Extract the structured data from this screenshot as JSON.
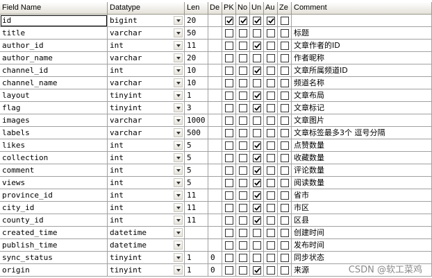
{
  "headers": [
    "Field Name",
    "Datatype",
    "Len",
    "De",
    "PK",
    "No",
    "Un",
    "Au",
    "Ze",
    "Comment"
  ],
  "rows": [
    {
      "name": "id",
      "type": "bigint",
      "len": "20",
      "def": "",
      "pk": true,
      "nn": true,
      "un": true,
      "ai": true,
      "zf": false,
      "comment": ""
    },
    {
      "name": "title",
      "type": "varchar",
      "len": "50",
      "def": "",
      "pk": false,
      "nn": false,
      "un": false,
      "ai": false,
      "zf": false,
      "comment": "标题"
    },
    {
      "name": "author_id",
      "type": "int",
      "len": "11",
      "def": "",
      "pk": false,
      "nn": false,
      "un": true,
      "ai": false,
      "zf": false,
      "comment": "文章作者的ID"
    },
    {
      "name": "author_name",
      "type": "varchar",
      "len": "20",
      "def": "",
      "pk": false,
      "nn": false,
      "un": false,
      "ai": false,
      "zf": false,
      "comment": "作者昵称"
    },
    {
      "name": "channel_id",
      "type": "int",
      "len": "10",
      "def": "",
      "pk": false,
      "nn": false,
      "un": true,
      "ai": false,
      "zf": false,
      "comment": "文章所属频道ID"
    },
    {
      "name": "channel_name",
      "type": "varchar",
      "len": "10",
      "def": "",
      "pk": false,
      "nn": false,
      "un": false,
      "ai": false,
      "zf": false,
      "comment": "频道名称"
    },
    {
      "name": "layout",
      "type": "tinyint",
      "len": "1",
      "def": "",
      "pk": false,
      "nn": false,
      "un": true,
      "ai": false,
      "zf": false,
      "comment": "文章布局"
    },
    {
      "name": "flag",
      "type": "tinyint",
      "len": "3",
      "def": "",
      "pk": false,
      "nn": false,
      "un": true,
      "ai": false,
      "zf": false,
      "comment": "文章标记"
    },
    {
      "name": "images",
      "type": "varchar",
      "len": "1000",
      "def": "",
      "pk": false,
      "nn": false,
      "un": false,
      "ai": false,
      "zf": false,
      "comment": "文章图片"
    },
    {
      "name": "labels",
      "type": "varchar",
      "len": "500",
      "def": "",
      "pk": false,
      "nn": false,
      "un": false,
      "ai": false,
      "zf": false,
      "comment": "文章标签最多3个 逗号分隔"
    },
    {
      "name": "likes",
      "type": "int",
      "len": "5",
      "def": "",
      "pk": false,
      "nn": false,
      "un": true,
      "ai": false,
      "zf": false,
      "comment": "点赞数量"
    },
    {
      "name": "collection",
      "type": "int",
      "len": "5",
      "def": "",
      "pk": false,
      "nn": false,
      "un": true,
      "ai": false,
      "zf": false,
      "comment": "收藏数量"
    },
    {
      "name": "comment",
      "type": "int",
      "len": "5",
      "def": "",
      "pk": false,
      "nn": false,
      "un": true,
      "ai": false,
      "zf": false,
      "comment": "评论数量"
    },
    {
      "name": "views",
      "type": "int",
      "len": "5",
      "def": "",
      "pk": false,
      "nn": false,
      "un": true,
      "ai": false,
      "zf": false,
      "comment": "阅读数量"
    },
    {
      "name": "province_id",
      "type": "int",
      "len": "11",
      "def": "",
      "pk": false,
      "nn": false,
      "un": true,
      "ai": false,
      "zf": false,
      "comment": "省市"
    },
    {
      "name": "city_id",
      "type": "int",
      "len": "11",
      "def": "",
      "pk": false,
      "nn": false,
      "un": true,
      "ai": false,
      "zf": false,
      "comment": "市区"
    },
    {
      "name": "county_id",
      "type": "int",
      "len": "11",
      "def": "",
      "pk": false,
      "nn": false,
      "un": true,
      "ai": false,
      "zf": false,
      "comment": "区县"
    },
    {
      "name": "created_time",
      "type": "datetime",
      "len": "",
      "def": "",
      "pk": false,
      "nn": false,
      "un": false,
      "ai": false,
      "zf": false,
      "comment": "创建时间"
    },
    {
      "name": "publish_time",
      "type": "datetime",
      "len": "",
      "def": "",
      "pk": false,
      "nn": false,
      "un": false,
      "ai": false,
      "zf": false,
      "comment": "发布时间"
    },
    {
      "name": "sync_status",
      "type": "tinyint",
      "len": "1",
      "def": "0",
      "pk": false,
      "nn": false,
      "un": false,
      "ai": false,
      "zf": false,
      "comment": "同步状态"
    },
    {
      "name": "origin",
      "type": "tinyint",
      "len": "1",
      "def": "0",
      "pk": false,
      "nn": false,
      "un": true,
      "ai": false,
      "zf": false,
      "comment": "来源"
    }
  ],
  "watermark": "CSDN @软工菜鸡",
  "icons": {
    "dropdown": "dropdown-arrow-icon",
    "check": "checkmark-icon"
  },
  "colors": {
    "header_top": "#ffffff",
    "header_bottom": "#e4e1d8",
    "gridline": "#a0a0a0"
  }
}
